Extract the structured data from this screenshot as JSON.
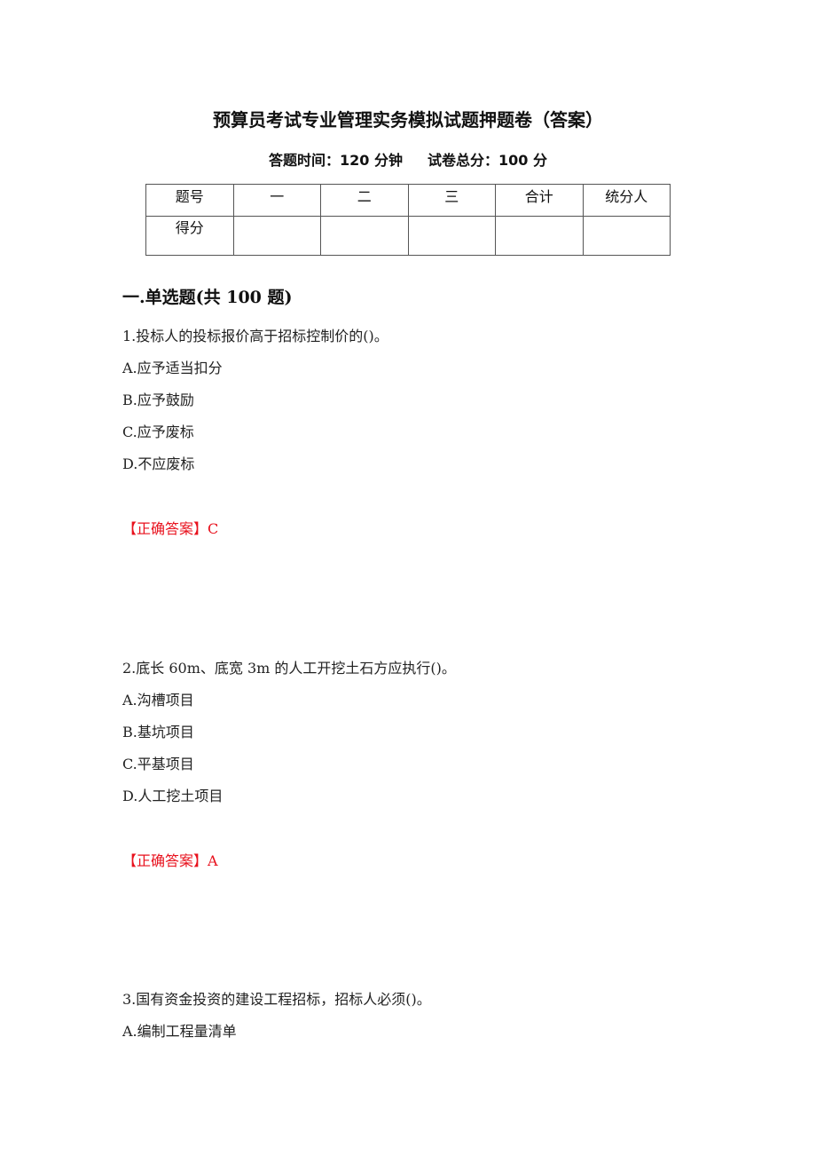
{
  "document": {
    "title": "预算员考试专业管理实务模拟试题押题卷（答案）",
    "exam_time_label": "答题时间：120 分钟",
    "total_score_label": "试卷总分：100 分"
  },
  "score_table": {
    "header": [
      "题号",
      "一",
      "二",
      "三",
      "合计",
      "统分人"
    ],
    "row_label": "得分",
    "row_values": [
      "",
      "",
      "",
      "",
      ""
    ]
  },
  "section": {
    "title": "一.单选题(共 100 题)"
  },
  "questions": [
    {
      "stem": "1.投标人的投标报价高于招标控制价的()。",
      "options": [
        "A.应予适当扣分",
        "B.应予鼓励",
        "C.应予废标",
        "D.不应废标"
      ],
      "answer_label": "【正确答案】C"
    },
    {
      "stem": "2.底长 60m、底宽 3m 的人工开挖土石方应执行()。",
      "options": [
        "A.沟槽项目",
        "B.基坑项目",
        "C.平基项目",
        "D.人工挖土项目"
      ],
      "answer_label": "【正确答案】A"
    },
    {
      "stem": "3.国有资金投资的建设工程招标，招标人必须()。",
      "options": [
        "A.编制工程量清单"
      ]
    }
  ],
  "colors": {
    "answer": "#e8101c",
    "text": "#222222"
  }
}
